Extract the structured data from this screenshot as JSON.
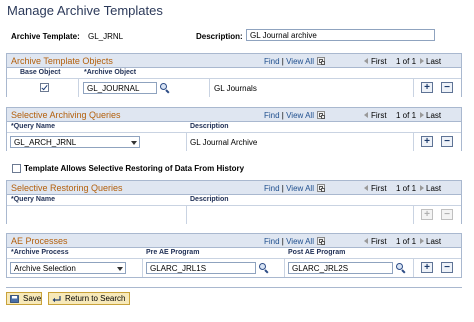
{
  "page": {
    "title": "Manage Archive Templates"
  },
  "header": {
    "archive_template_label": "Archive Template:",
    "archive_template_value": "GL_JRNL",
    "description_label": "Description:",
    "description_value": "GL Journal archive"
  },
  "nav": {
    "find": "Find",
    "view_all": "View All",
    "separator": "|",
    "first": "First",
    "range": "1 of 1",
    "last": "Last"
  },
  "archive_objects": {
    "caption": "Archive Template Objects",
    "columns": {
      "base_object": "Base Object",
      "archive_object": "*Archive Object"
    },
    "row": {
      "base_object_checked": true,
      "archive_object": "GL_JOURNAL",
      "description": "GL Journals"
    }
  },
  "archiving_queries": {
    "caption": "Selective Archiving Queries",
    "columns": {
      "query_name": "*Query Name",
      "description": "Description"
    },
    "row": {
      "query_name": "GL_ARCH_JRNL",
      "description": "GL Journal Archive"
    }
  },
  "allow_restore": {
    "label": "Template Allows Selective Restoring of Data From History",
    "checked": false
  },
  "restoring_queries": {
    "caption": "Selective Restoring Queries",
    "columns": {
      "query_name": "*Query Name",
      "description": "Description"
    }
  },
  "ae_processes": {
    "caption": "AE Processes",
    "columns": {
      "archive_process": "*Archive Process",
      "pre_ae": "Pre AE Program",
      "post_ae": "Post AE Program"
    },
    "row": {
      "archive_process": "Archive Selection",
      "pre_ae": "GLARC_JRL1S",
      "post_ae": "GLARC_JRL2S"
    }
  },
  "buttons": {
    "plus": "+",
    "minus": "−",
    "save": "Save",
    "return_to_search": "Return to Search"
  },
  "colors": {
    "caption": "#b35f0b",
    "link": "#1f4f8e",
    "grid_header": "#dfe6f1"
  }
}
